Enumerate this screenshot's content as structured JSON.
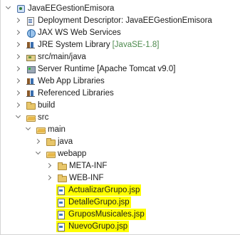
{
  "explorer": {
    "items": [
      {
        "label": "JavaEEGestionEmisora",
        "icon": "project-icon",
        "expanded": true
      },
      {
        "label": "Deployment Descriptor: JavaEEGestionEmisora",
        "icon": "deployment-descriptor-icon",
        "expanded": false
      },
      {
        "label": "JAX WS Web Services",
        "icon": "web-services-icon",
        "expanded": false
      },
      {
        "label": "JRE System Library",
        "suffix": "[JavaSE-1.8]",
        "icon": "library-icon",
        "expanded": false
      },
      {
        "label": "src/main/java",
        "icon": "source-folder-icon",
        "expanded": false
      },
      {
        "label": "Server Runtime [Apache Tomcat v9.0]",
        "icon": "server-runtime-icon",
        "expanded": false
      },
      {
        "label": "Web App Libraries",
        "icon": "library-icon",
        "expanded": false
      },
      {
        "label": "Referenced Libraries",
        "icon": "library-icon",
        "expanded": false
      },
      {
        "label": "build",
        "icon": "folder-icon",
        "expanded": false
      },
      {
        "label": "src",
        "icon": "folder-open-icon",
        "expanded": true
      },
      {
        "label": "main",
        "icon": "folder-open-icon",
        "expanded": true
      },
      {
        "label": "java",
        "icon": "folder-icon",
        "expanded": false
      },
      {
        "label": "webapp",
        "icon": "folder-open-icon",
        "expanded": true
      },
      {
        "label": "META-INF",
        "icon": "folder-icon",
        "expanded": false
      },
      {
        "label": "WEB-INF",
        "icon": "folder-icon",
        "expanded": false
      },
      {
        "label": "ActualizarGrupo.jsp",
        "icon": "jsp-file-icon",
        "highlighted": true
      },
      {
        "label": "DetalleGrupo.jsp",
        "icon": "jsp-file-icon",
        "highlighted": true
      },
      {
        "label": "GruposMusicales.jsp",
        "icon": "jsp-file-icon",
        "highlighted": true
      },
      {
        "label": "NuevoGrupo.jsp",
        "icon": "jsp-file-icon",
        "highlighted": true
      }
    ],
    "suffix_color": "#4d8a4d",
    "highlight_color": "#ffff00"
  }
}
